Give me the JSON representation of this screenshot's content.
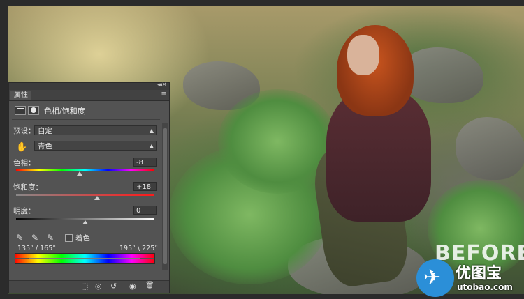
{
  "panel": {
    "tab_label": "属性",
    "adjustment_title": "色相/饱和度",
    "preset_label": "预设：",
    "preset_value": "自定",
    "channel_value": "青色",
    "hue": {
      "label": "色相：",
      "value": "-8",
      "fraction": 0.46
    },
    "saturation": {
      "label": "饱和度：",
      "value": "+18",
      "fraction": 0.59
    },
    "lightness": {
      "label": "明度：",
      "value": "0",
      "fraction": 0.5
    },
    "colorize_label": "着色",
    "range_left": "135° / 165°",
    "range_right": "195° \\ 225°"
  },
  "image": {
    "overlay_text": "BEFORE"
  },
  "watermark": {
    "title": "优图宝",
    "url": "utobao.com"
  },
  "icons": {
    "hand": "✋",
    "dropper": "✎",
    "dropper_plus": "✎",
    "dropper_minus": "✎",
    "arrow_down": "▾",
    "menu": "≡",
    "close": "✕",
    "collapse": "◂◂",
    "clip": "⬚",
    "eye_prev": "◎",
    "reset": "↺",
    "eye": "◉",
    "trash": "🗑",
    "bird": "✈"
  },
  "colors": {
    "panel_bg": "#535353",
    "watermark_blue": "#2b8fd8"
  }
}
